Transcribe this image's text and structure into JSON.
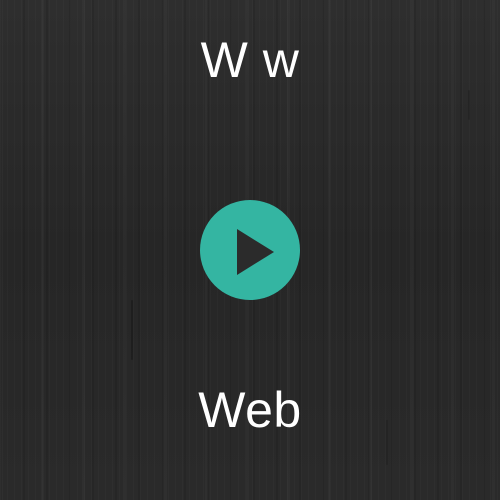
{
  "title": "W w",
  "subtitle": "Web",
  "play_button": {
    "icon": "play-icon",
    "color": "#34b5a2",
    "triangle_color": "#2b2b2b"
  },
  "background": {
    "color": "#2b2b2b",
    "texture": "dark wood"
  },
  "text_color": "#ffffff"
}
